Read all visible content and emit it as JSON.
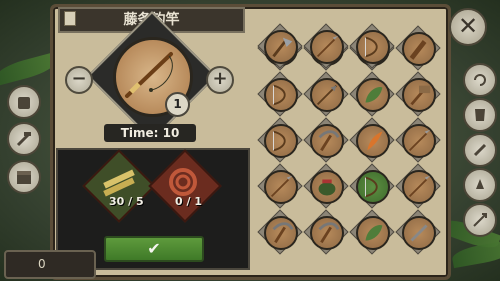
{
  "title": "藤条钓竿",
  "item": {
    "quantity": "1"
  },
  "controls": {
    "minus": "−",
    "plus": "+",
    "close": "✕",
    "craft": "✔"
  },
  "time_label": "Time: 10",
  "ingredients": [
    {
      "name": "bamboo",
      "label": "30 / 5"
    },
    {
      "name": "rope",
      "label": "0 / 1"
    }
  ],
  "grid_items": [
    "necklace",
    "axe",
    "basket",
    "club",
    "bow",
    "arrow",
    "leaf",
    "hammer",
    "bow",
    "pickaxe",
    "feather",
    "spear",
    "spear",
    "pot",
    "bow",
    "spear",
    "pickaxe",
    "pickaxe",
    "leaf",
    "tool",
    "axe",
    "spear",
    "bow"
  ],
  "sidebar": [
    "backpack-icon",
    "crafting-icon",
    "chest-icon"
  ],
  "right_sidebar": [
    "refresh-icon",
    "armor-icon",
    "tools-icon",
    "campfire-icon",
    "weapon-icon"
  ],
  "bottom_counter": "0"
}
